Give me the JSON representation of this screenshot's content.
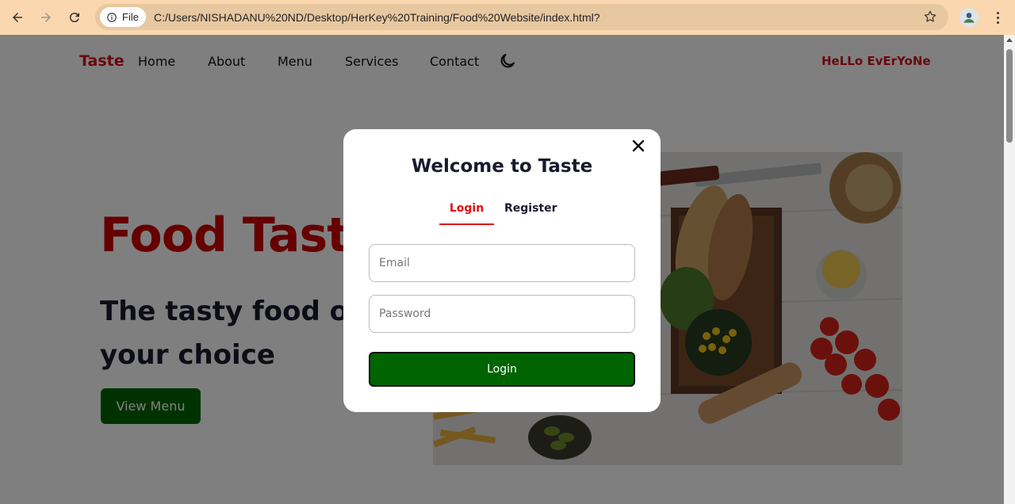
{
  "browser": {
    "file_label": "File",
    "url": "C:/Users/NISHADANU%20ND/Desktop/HerKey%20Training/Food%20Website/index.html?"
  },
  "navbar": {
    "brand": "Taste",
    "links": [
      "Home",
      "About",
      "Menu",
      "Services",
      "Contact"
    ],
    "greeting": "HeLLo EvErYoNe"
  },
  "hero": {
    "title": "Food Taste",
    "subtitle": "The tasty food of your choice",
    "button": "View Menu"
  },
  "modal": {
    "title": "Welcome to Taste",
    "tabs": [
      "Login",
      "Register"
    ],
    "active_tab": "Login",
    "email_placeholder": "Email",
    "password_placeholder": "Password",
    "submit": "Login"
  },
  "colors": {
    "brand_red": "#d3121a",
    "button_green": "#006400",
    "chrome_bar": "#fbd7b0"
  }
}
